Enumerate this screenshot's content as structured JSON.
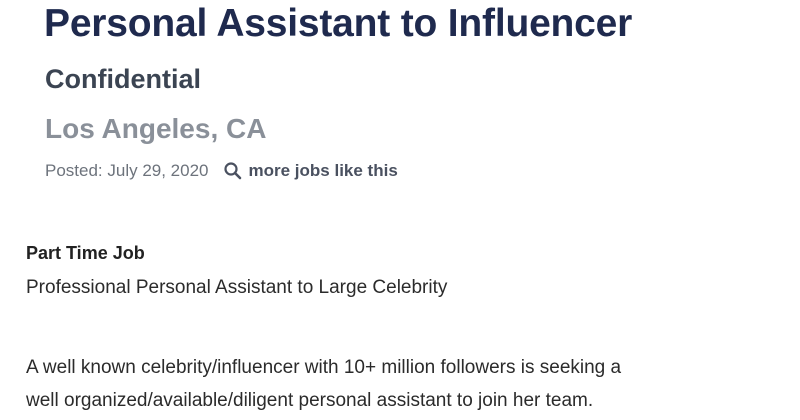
{
  "job": {
    "title": "Personal Assistant to Influencer",
    "company": "Confidential",
    "location": "Los Angeles, CA",
    "posted": "Posted: July 29, 2020",
    "more_jobs_label": "more jobs like this",
    "more_jobs_icon": "search-icon"
  },
  "details": {
    "job_type": "Part Time Job",
    "summary": "Professional Personal Assistant to Large Celebrity",
    "description_lines": [
      "A well known celebrity/influencer with 10+ million followers is seeking a",
      "well organized/available/diligent personal assistant to join her team."
    ]
  },
  "colors": {
    "title": "#1f2a4e",
    "company": "#3b4452",
    "location": "#8a9099",
    "body_text": "#2b2b2b"
  }
}
